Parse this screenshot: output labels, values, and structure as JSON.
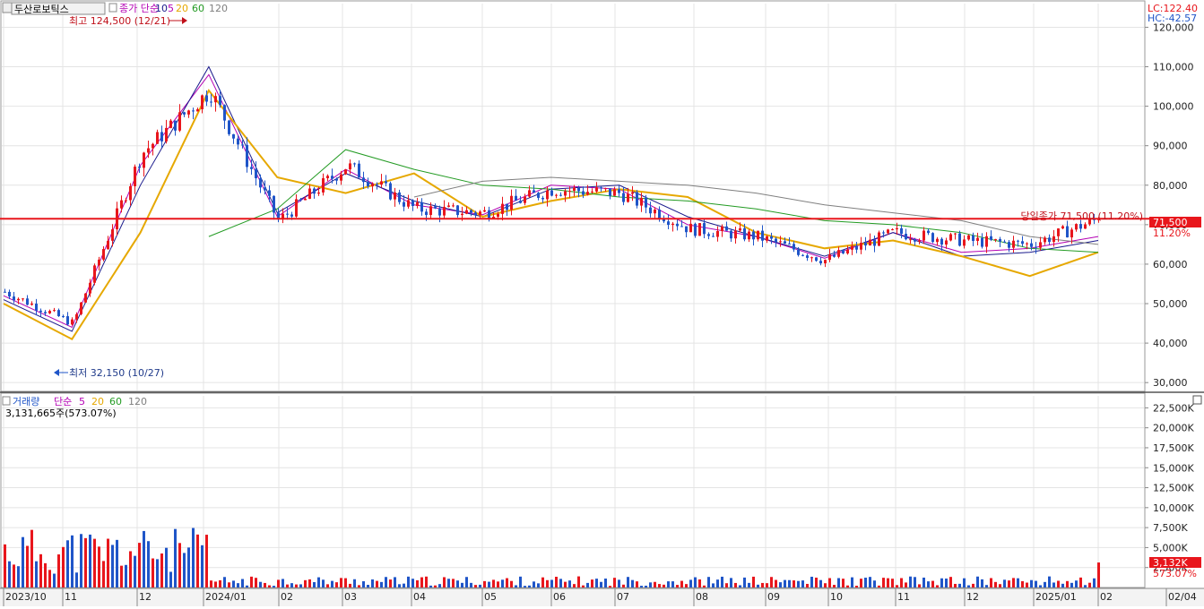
{
  "price_panel": {
    "stock_name": "두산로보틱스",
    "ma_legend": {
      "label": "종가 단순",
      "periods": [
        "5",
        "10",
        "20",
        "60",
        "120"
      ]
    },
    "lc_label": "LC:122.40",
    "hc_label": "HC:-42.57",
    "high_label": "최고 124,500 (12/21)",
    "low_label": "최저 32,150 (10/27)",
    "close_label": "당일종가 71,500 (11.20%)",
    "close_tag": "71,500",
    "close_pct_tag": "11.20%"
  },
  "volume_panel": {
    "title": "거래량",
    "ma_legend": {
      "label": "단순",
      "periods": [
        "5",
        "20",
        "60",
        "120"
      ]
    },
    "last_value_label": "3,131,665주(573.07%)",
    "volume_tag": "3,132K",
    "volume_pct_tag": "573.07%"
  },
  "colors": {
    "up": "#e8161c",
    "down": "#1f55c8",
    "ma5": "#b400b4",
    "ma10": "#1a1a8c",
    "ma20": "#e6a800",
    "ma60": "#239b23",
    "ma120": "#7f7f7f",
    "close_line": "#e8161c",
    "grid": "#e4e4e4"
  },
  "chart_data": [
    {
      "type": "candlestick",
      "title": "두산로보틱스",
      "y_ticks": [
        "120,000",
        "110,000",
        "100,000",
        "90,000",
        "80,000",
        "70,000",
        "60,000",
        "50,000",
        "40,000",
        "30,000"
      ],
      "y_tick_values": [
        120000,
        110000,
        100000,
        90000,
        80000,
        70000,
        60000,
        50000,
        40000,
        30000
      ],
      "ylim": [
        28000,
        126000
      ],
      "max": {
        "date": "2023-12-21",
        "value": 124500
      },
      "min": {
        "date": "2023-10-27",
        "value": 32150
      },
      "last_close": 71500,
      "last_change_pct": 11.2,
      "series": [
        {
          "name": "종가 (월초 근사치)",
          "x": [
            "2023-10",
            "2023-11",
            "2023-12",
            "2024-01",
            "2024-02",
            "2024-03",
            "2024-04",
            "2024-05",
            "2024-06",
            "2024-07",
            "2024-08",
            "2024-09",
            "2024-10",
            "2024-11",
            "2024-12",
            "2025-01",
            "2025-02"
          ],
          "values": [
            53000,
            45000,
            88000,
            104000,
            71000,
            85000,
            74000,
            73000,
            79000,
            78000,
            69000,
            67000,
            61000,
            68000,
            66000,
            65000,
            71500
          ]
        },
        {
          "name": "5",
          "values": [
            52000,
            44000,
            85000,
            108000,
            72000,
            84000,
            75000,
            72500,
            80000,
            79000,
            70000,
            67000,
            61500,
            68000,
            63000,
            64000,
            67000
          ]
        },
        {
          "name": "10",
          "values": [
            51000,
            43000,
            80000,
            110000,
            73000,
            83000,
            76000,
            72000,
            79000,
            80000,
            72000,
            67000,
            62000,
            68000,
            62000,
            63000,
            66000
          ]
        },
        {
          "name": "20",
          "values": [
            50000,
            41000,
            68000,
            104000,
            82000,
            78000,
            83000,
            72000,
            76000,
            79000,
            77000,
            68000,
            64000,
            66000,
            62000,
            57000,
            63000
          ]
        },
        {
          "name": "60",
          "values": [
            null,
            null,
            null,
            67000,
            74000,
            89000,
            84000,
            80000,
            79000,
            77000,
            76000,
            74000,
            71000,
            70000,
            68000,
            64000,
            63000
          ]
        },
        {
          "name": "120",
          "values": [
            null,
            null,
            null,
            null,
            null,
            null,
            77000,
            81000,
            82000,
            81000,
            80000,
            78000,
            75000,
            73000,
            71000,
            67000,
            65000
          ]
        }
      ]
    },
    {
      "type": "bar",
      "title": "거래량",
      "y_ticks": [
        "22,500K",
        "20,000K",
        "17,500K",
        "15,000K",
        "12,500K",
        "10,000K",
        "7,500K",
        "5,000K",
        "2,500K"
      ],
      "y_tick_values": [
        22500,
        20000,
        17500,
        15000,
        12500,
        10000,
        7500,
        5000,
        2500
      ],
      "ylim": [
        0,
        24000
      ],
      "unit": "K",
      "last_value": 3132,
      "last_change_pct": 573.07
    }
  ],
  "x_axis_labels": [
    {
      "text": "2023/10"
    },
    {
      "text": "11"
    },
    {
      "text": "12"
    },
    {
      "text": "2024/01"
    },
    {
      "text": "02"
    },
    {
      "text": "03"
    },
    {
      "text": "04"
    },
    {
      "text": "05"
    },
    {
      "text": "06"
    },
    {
      "text": "07"
    },
    {
      "text": "08"
    },
    {
      "text": "09"
    },
    {
      "text": "10"
    },
    {
      "text": "11"
    },
    {
      "text": "12"
    },
    {
      "text": "2025/01"
    },
    {
      "text": "02"
    },
    {
      "text": "02/04"
    }
  ]
}
